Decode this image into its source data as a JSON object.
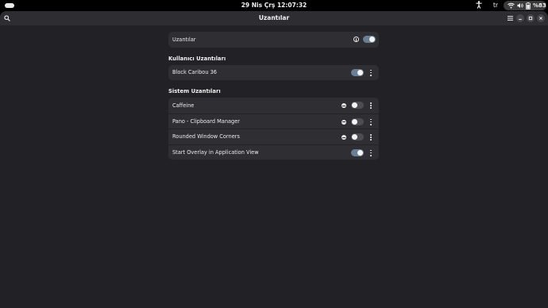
{
  "topbar": {
    "clock": "29 Nis Çrş  12:07:32",
    "keyboard_layout": "tr",
    "battery": "%83",
    "accessibility_icon": "accessibility-icon",
    "wifi_icon": "wifi-icon",
    "volume_icon": "volume-icon",
    "battery_icon": "battery-icon"
  },
  "window": {
    "title": "Uzantılar",
    "search_icon": "search-icon",
    "menu_icon": "hamburger-menu-icon",
    "minimize_icon": "minimize-icon",
    "maximize_icon": "maximize-icon",
    "close_icon": "close-icon"
  },
  "master": {
    "label": "Uzantılar",
    "enabled": true
  },
  "user_section": {
    "title": "Kullanıcı Uzantıları",
    "items": [
      {
        "label": "Block Caribou 36",
        "enabled": true
      }
    ]
  },
  "system_section": {
    "title": "Sistem Uzantıları",
    "items": [
      {
        "label": "Caffeine",
        "enabled": false,
        "has_error": true
      },
      {
        "label": "Pano - Clipboard Manager",
        "enabled": false,
        "has_error": true
      },
      {
        "label": "Rounded Window Corners",
        "enabled": false,
        "has_error": true
      },
      {
        "label": "Start Overlay in Application View",
        "enabled": true,
        "has_error": false
      }
    ]
  },
  "colors": {
    "switch_on": "#6b7f94",
    "switch_off": "#4d4d52",
    "window_bg": "#222226",
    "card_bg": "#2e2e33"
  }
}
